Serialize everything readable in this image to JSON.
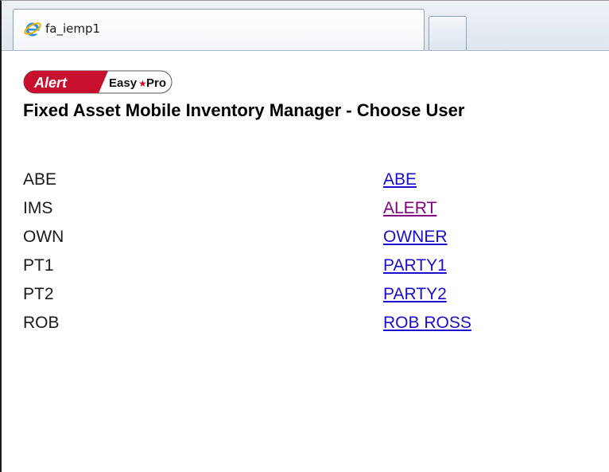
{
  "browser": {
    "tab_title": "fa_iemp1",
    "tab_icon": "ie-browser-icon"
  },
  "header": {
    "logo_text_alert": "Alert",
    "logo_text_easy": "Easy",
    "logo_text_pro": "Pro",
    "title": "Fixed Asset Mobile Inventory Manager - Choose User"
  },
  "users": [
    {
      "code": "ABE",
      "name": "ABE",
      "visited": false
    },
    {
      "code": "IMS",
      "name": "ALERT",
      "visited": true
    },
    {
      "code": "OWN",
      "name": "OWNER",
      "visited": false
    },
    {
      "code": "PT1",
      "name": "PARTY1",
      "visited": false
    },
    {
      "code": "PT2",
      "name": "PARTY2",
      "visited": false
    },
    {
      "code": "ROB",
      "name": "ROB ROSS",
      "visited": false
    }
  ],
  "colors": {
    "link": "#1a0dcc",
    "visited_link": "#800080",
    "logo_red": "#c8102e"
  }
}
